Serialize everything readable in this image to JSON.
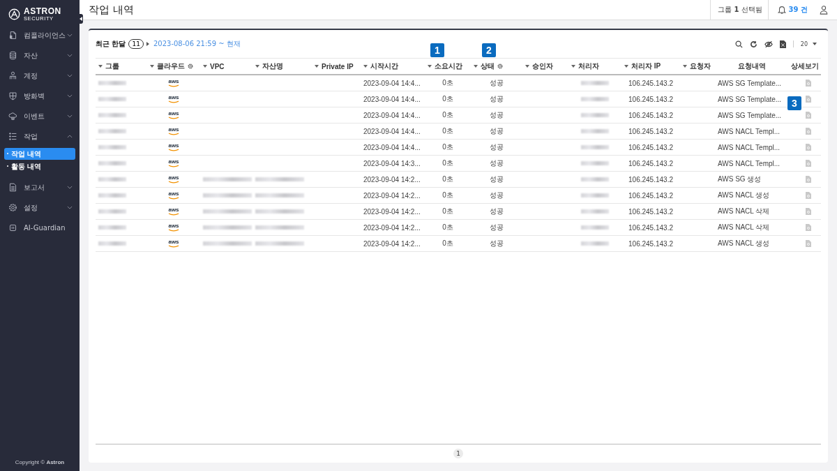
{
  "brand": {
    "name": "ASTRON",
    "tagline": "SECURITY"
  },
  "sidebar": {
    "items": [
      {
        "label": "컴플라이언스",
        "kind": "group",
        "expanded": false
      },
      {
        "label": "자산",
        "kind": "group",
        "expanded": false
      },
      {
        "label": "계정",
        "kind": "group",
        "expanded": false
      },
      {
        "label": "방화벽",
        "kind": "group",
        "expanded": false
      },
      {
        "label": "이벤트",
        "kind": "group",
        "expanded": false
      },
      {
        "label": "작업",
        "kind": "group",
        "expanded": true,
        "children": [
          {
            "label": "작업 내역",
            "selected": true
          },
          {
            "label": "활동 내역",
            "selected": false
          }
        ]
      },
      {
        "label": "보고서",
        "kind": "group",
        "expanded": false
      },
      {
        "label": "설정",
        "kind": "group",
        "expanded": false
      },
      {
        "label": "AI-Guardian",
        "kind": "link"
      }
    ],
    "copyright": "Copyright © **Astron**"
  },
  "header": {
    "title": "작업 내역",
    "group_selection": "그룹 **1** 선택됨",
    "notifications": "39 건"
  },
  "filter": {
    "period": "최근 한달",
    "count": "11",
    "range": "2023-08-06 21:59 ~ 현재"
  },
  "toolbar": {
    "page_size": "20"
  },
  "callouts": [
    "1",
    "2",
    "3"
  ],
  "table": {
    "columns": [
      {
        "label": "그룹",
        "sortable": true,
        "settings": false
      },
      {
        "label": "클라우드",
        "sortable": true,
        "settings": true
      },
      {
        "label": "VPC",
        "sortable": true,
        "settings": false
      },
      {
        "label": "자산명",
        "sortable": true,
        "settings": false
      },
      {
        "label": "Private IP",
        "sortable": true,
        "settings": false
      },
      {
        "label": "시작시간",
        "sortable": true,
        "settings": false
      },
      {
        "label": "소요시간",
        "sortable": true,
        "settings": false
      },
      {
        "label": "상태",
        "sortable": true,
        "settings": true
      },
      {
        "label": "승인자",
        "sortable": true,
        "settings": false
      },
      {
        "label": "처리자",
        "sortable": true,
        "settings": false
      },
      {
        "label": "처리자 IP",
        "sortable": true,
        "settings": false
      },
      {
        "label": "요청자",
        "sortable": true,
        "settings": false
      },
      {
        "label": "요청내역",
        "sortable": false,
        "settings": false
      },
      {
        "label": "상세보기",
        "sortable": false,
        "settings": false
      }
    ],
    "rows": [
      {
        "cloud": "aws",
        "vpc_redacted": false,
        "asset_redacted": false,
        "start": "2023-09-04 14:4...",
        "duration": "0초",
        "status": "성공",
        "handler_ip": "106.245.143.2",
        "request": "AWS SG Template..."
      },
      {
        "cloud": "aws",
        "vpc_redacted": false,
        "asset_redacted": false,
        "start": "2023-09-04 14:4...",
        "duration": "0초",
        "status": "성공",
        "handler_ip": "106.245.143.2",
        "request": "AWS SG Template..."
      },
      {
        "cloud": "aws",
        "vpc_redacted": false,
        "asset_redacted": false,
        "start": "2023-09-04 14:4...",
        "duration": "0초",
        "status": "성공",
        "handler_ip": "106.245.143.2",
        "request": "AWS SG Template..."
      },
      {
        "cloud": "aws",
        "vpc_redacted": false,
        "asset_redacted": false,
        "start": "2023-09-04 14:4...",
        "duration": "0초",
        "status": "성공",
        "handler_ip": "106.245.143.2",
        "request": "AWS NACL Templ..."
      },
      {
        "cloud": "aws",
        "vpc_redacted": false,
        "asset_redacted": false,
        "start": "2023-09-04 14:4...",
        "duration": "0초",
        "status": "성공",
        "handler_ip": "106.245.143.2",
        "request": "AWS NACL Templ..."
      },
      {
        "cloud": "aws",
        "vpc_redacted": false,
        "asset_redacted": false,
        "start": "2023-09-04 14:3...",
        "duration": "0초",
        "status": "성공",
        "handler_ip": "106.245.143.2",
        "request": "AWS NACL Templ..."
      },
      {
        "cloud": "aws",
        "vpc_redacted": true,
        "asset_redacted": true,
        "start": "2023-09-04 14:2...",
        "duration": "0초",
        "status": "성공",
        "handler_ip": "106.245.143.2",
        "request": "AWS SG 생성"
      },
      {
        "cloud": "aws",
        "vpc_redacted": true,
        "asset_redacted": true,
        "start": "2023-09-04 14:2...",
        "duration": "0초",
        "status": "성공",
        "handler_ip": "106.245.143.2",
        "request": "AWS NACL 생성"
      },
      {
        "cloud": "aws",
        "vpc_redacted": true,
        "asset_redacted": true,
        "start": "2023-09-04 14:2...",
        "duration": "0초",
        "status": "성공",
        "handler_ip": "106.245.143.2",
        "request": "AWS NACL 삭제"
      },
      {
        "cloud": "aws",
        "vpc_redacted": true,
        "asset_redacted": true,
        "start": "2023-09-04 14:2...",
        "duration": "0초",
        "status": "성공",
        "handler_ip": "106.245.143.2",
        "request": "AWS NACL 삭제"
      },
      {
        "cloud": "aws",
        "vpc_redacted": true,
        "asset_redacted": true,
        "start": "2023-09-04 14:2...",
        "duration": "0초",
        "status": "성공",
        "handler_ip": "106.245.143.2",
        "request": "AWS NACL 생성"
      }
    ]
  },
  "pagination": [
    {
      "label": "1",
      "selected": true
    }
  ]
}
